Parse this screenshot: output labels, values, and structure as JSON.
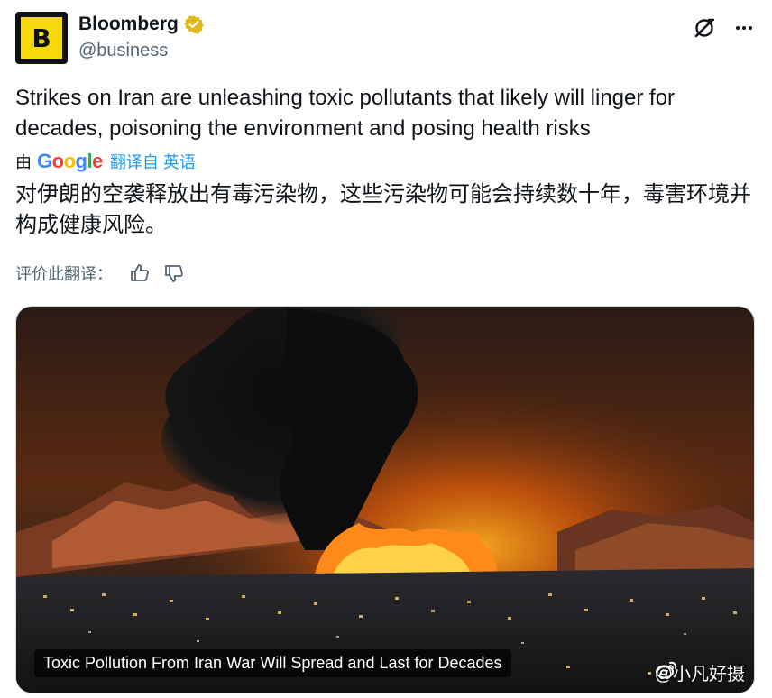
{
  "account": {
    "avatar_letter": "B",
    "name": "Bloomberg",
    "handle": "@business",
    "verified": true,
    "verified_color": "#e2b719",
    "avatar_color": "#f5d90a"
  },
  "icons": {
    "grok": "grok-icon",
    "more": "more-icon",
    "thumb_up": "thumbs-up-icon",
    "thumb_down": "thumbs-down-icon",
    "weibo": "weibo-icon"
  },
  "tweet": {
    "text": "Strikes on Iran are unleashing toxic pollutants that likely will linger for decades, poisoning the environment and posing health risks"
  },
  "translation": {
    "by": "由",
    "provider": "Google",
    "link": "翻译自 英语",
    "text": "对伊朗的空袭释放出有毒污染物，这些污染物可能会持续数十年，毒害环境并构成健康风险。",
    "rate_label": "评价此翻译："
  },
  "media": {
    "caption": "Toxic Pollution From Iran War Will Spread and Last for Decades"
  },
  "watermark": {
    "text": "@小凡好摄"
  },
  "colors": {
    "link": "#1d9bf0",
    "secondary_text": "#536471"
  }
}
